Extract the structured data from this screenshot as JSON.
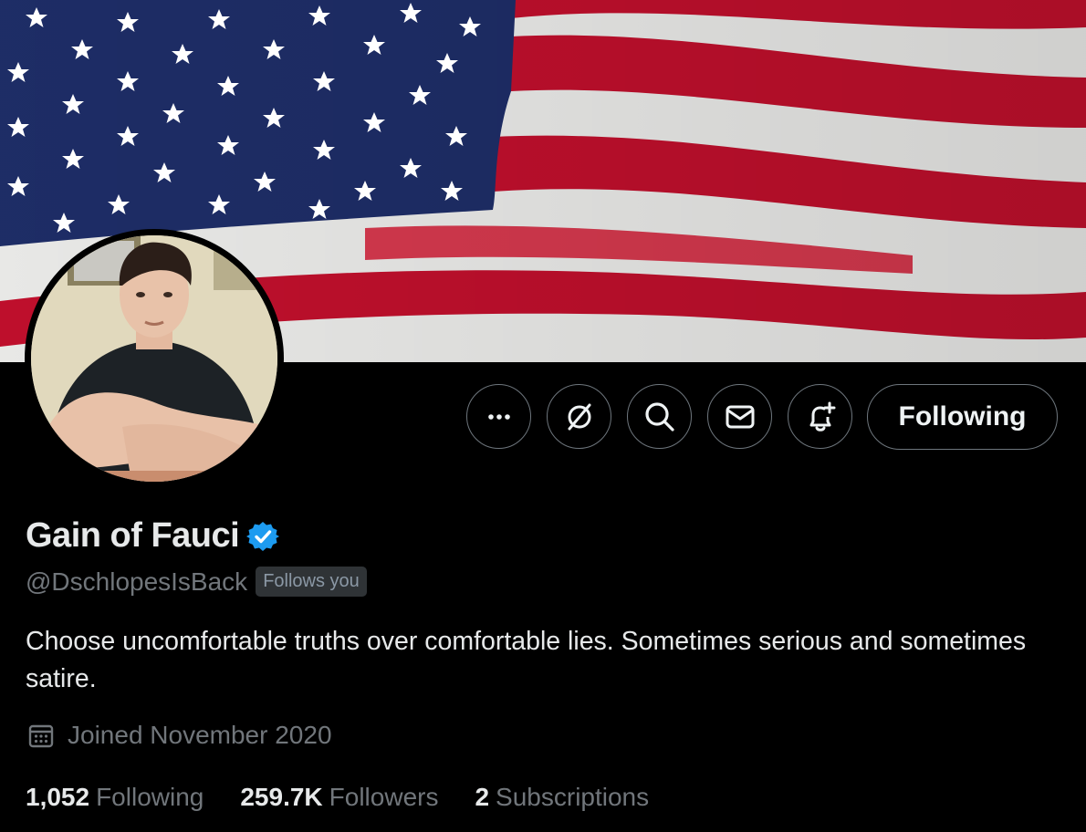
{
  "profile": {
    "display_name": "Gain of Fauci",
    "handle": "@DschlopesIsBack",
    "follows_you": "Follows you",
    "bio": "Choose uncomfortable truths over comfortable lies.  Sometimes serious and sometimes satire.",
    "joined": "Joined November 2020",
    "verified": true
  },
  "actions": {
    "more_icon": "more-icon",
    "grok_icon": "grok-icon",
    "search_icon": "search-icon",
    "message_icon": "message-icon",
    "notify_icon": "bell-plus-icon",
    "following_label": "Following"
  },
  "stats": {
    "following_count": "1,052",
    "following_label": "Following",
    "followers_count": "259.7K",
    "followers_label": "Followers",
    "subscriptions_count": "2",
    "subscriptions_label": "Subscriptions"
  },
  "colors": {
    "background": "#000000",
    "text_primary": "#e7e9ea",
    "text_secondary": "#71767b",
    "verified_blue": "#1d9bf0",
    "button_border": "#6e767d"
  }
}
